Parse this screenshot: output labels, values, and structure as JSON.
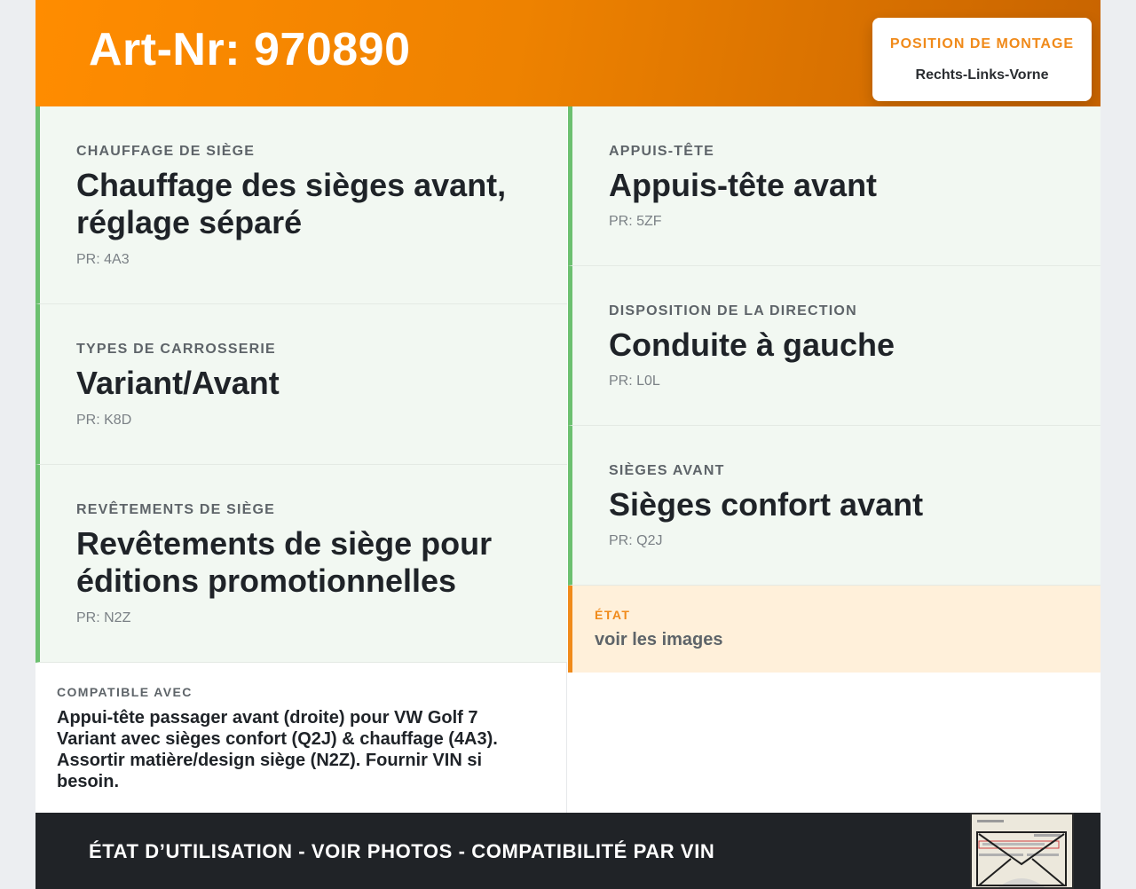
{
  "header": {
    "title": "Art-Nr: 970890",
    "mount_label": "POSITION DE MONTAGE",
    "mount_value": "Rechts-Links-Vorne"
  },
  "left_cells": [
    {
      "label": "CHAUFFAGE DE SIÈGE",
      "value": "Chauffage des sièges avant, réglage séparé",
      "pr": "PR: 4A3"
    },
    {
      "label": "TYPES DE CARROSSERIE",
      "value": "Variant/Avant",
      "pr": "PR: K8D"
    },
    {
      "label": "REVÊTEMENTS DE SIÈGE",
      "value": "Revêtements de siège pour éditions promotionnelles",
      "pr": "PR: N2Z"
    }
  ],
  "right_cells": [
    {
      "label": "APPUIS-TÊTE",
      "value": "Appuis-tête avant",
      "pr": "PR: 5ZF"
    },
    {
      "label": "DISPOSITION DE LA DIRECTION",
      "value": "Conduite à gauche",
      "pr": "PR: L0L"
    },
    {
      "label": "SIÈGES AVANT",
      "value": "Sièges confort avant",
      "pr": "PR: Q2J"
    }
  ],
  "state": {
    "label": "ÉTAT",
    "value": "voir les images"
  },
  "compat": {
    "label": "COMPATIBLE AVEC",
    "text": "Appui-tête passager avant (droite) pour VW Golf 7 Variant avec sièges confort (Q2J) & chauffage (4A3). Assortir matière/design siège (N2Z). Fournir VIN si besoin."
  },
  "footer": {
    "text": "ÉTAT D’UTILISATION - VOIR PHOTOS - COMPATIBILITÉ PAR VIN"
  },
  "colors": {
    "accent_orange": "#f08a1a",
    "accent_green": "#6cc070",
    "footer_bg": "#202327"
  }
}
